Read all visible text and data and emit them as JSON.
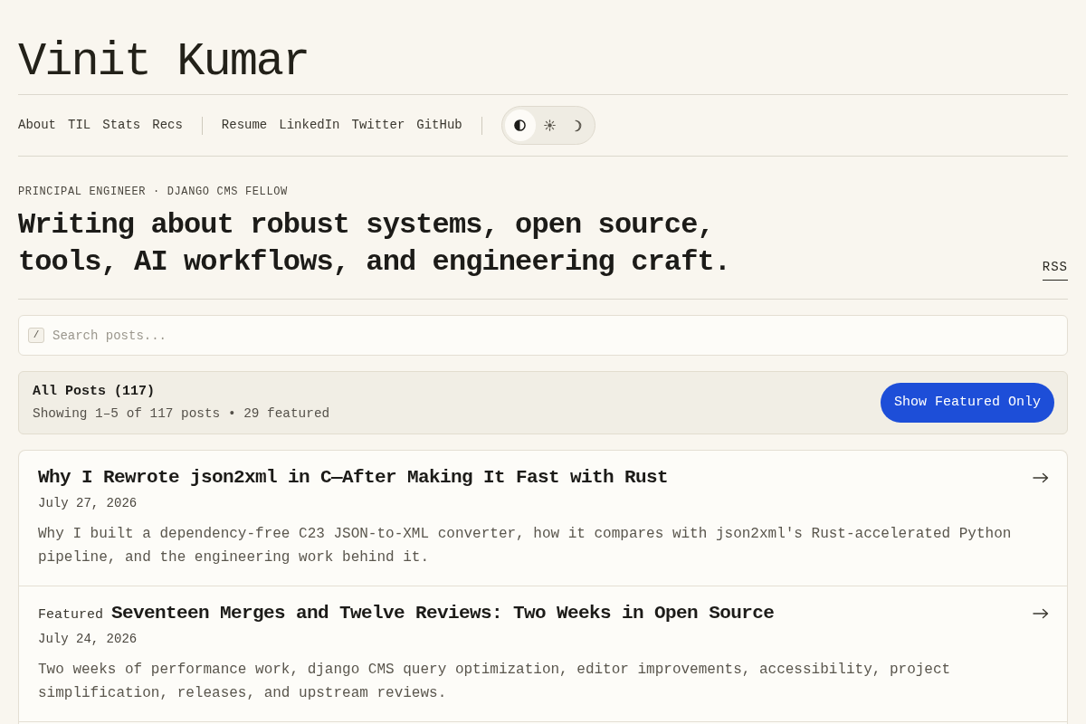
{
  "site": {
    "title": "Vinit Kumar"
  },
  "nav": {
    "groups": [
      {
        "links": [
          "About",
          "TIL",
          "Stats",
          "Recs"
        ]
      },
      {
        "links": [
          "Resume",
          "LinkedIn",
          "Twitter",
          "GitHub"
        ]
      }
    ],
    "theme_options": [
      {
        "kind": "auto",
        "selected": true
      },
      {
        "kind": "light",
        "selected": false
      },
      {
        "kind": "dark",
        "selected": false
      }
    ]
  },
  "intro": {
    "kicker": "PRINCIPAL ENGINEER · DJANGO CMS FELLOW",
    "headline": "Writing about robust systems, open source, tools, AI workflows, and engineering craft.",
    "rss": "RSS"
  },
  "search": {
    "shortcut": "/",
    "placeholder": "Search posts..."
  },
  "filter": {
    "title": "All Posts (117)",
    "summary": "Showing 1–5 of 117 posts • 29 featured",
    "button": "Show Featured Only"
  },
  "posts": [
    {
      "title": "Why I Rewrote json2xml in C—After Making It Fast with Rust",
      "date": "July 27, 2026",
      "description": "Why I built a dependency-free C23 JSON-to-XML converter, how it compares with json2xml's Rust-accelerated Python pipeline, and the engineering work behind it."
    },
    {
      "badge": "Featured",
      "title": "Seventeen Merges and Twelve Reviews: Two Weeks in Open Source",
      "date": "July 24, 2026",
      "description": "Two weeks of performance work, django CMS query optimization, editor improvements, accessibility, project simplification, releases, and upstream reviews."
    }
  ]
}
